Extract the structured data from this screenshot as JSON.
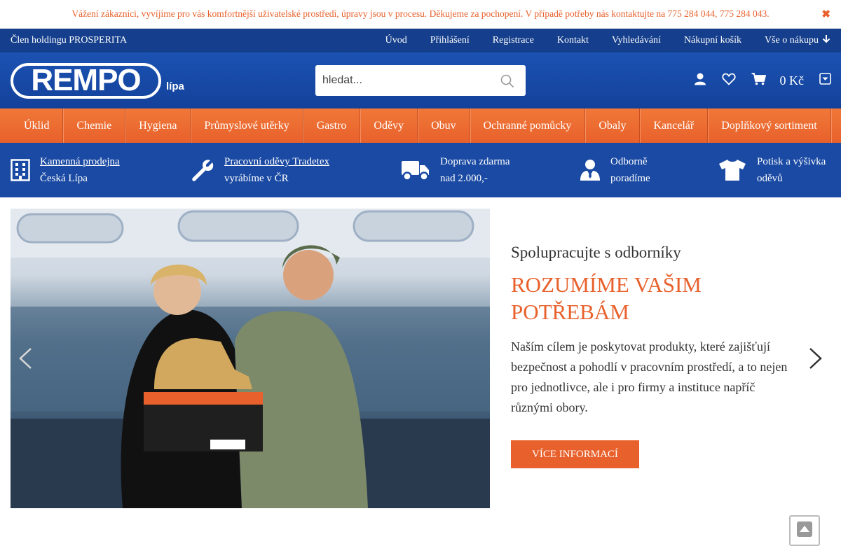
{
  "notice": {
    "text": "Vážení zákazníci, vyvíjíme pro vás komfortnější uživatelské prostředí, úpravy jsou v procesu. Děkujeme za pochopení. V případě potřeby nás kontaktujte na 775 284 044, 775 284 043.",
    "close_icon": "✖"
  },
  "topbar": {
    "holding": "Člen holdingu PROSPERITA",
    "links": [
      "Úvod",
      "Přihlášení",
      "Registrace",
      "Kontakt",
      "Vyhledávání",
      "Nákupní košík",
      "Vše o nákupu"
    ]
  },
  "header": {
    "logo_text": "REMPO",
    "logo_sub": "lípa",
    "search_placeholder": "hledat...",
    "cart_total": "0 Kč"
  },
  "categories": [
    "Úklid",
    "Chemie",
    "Hygiena",
    "Průmyslové utěrky",
    "Gastro",
    "Oděvy",
    "Obuv",
    "Ochranné pomůcky",
    "Obaly",
    "Kancelář",
    "Doplňkový sortiment"
  ],
  "benefits": [
    {
      "line1": "Kamenná prodejna",
      "line2": "Česká Lípa",
      "icon": "building-icon"
    },
    {
      "line1": "Pracovní oděvy Tradetex",
      "line2": "vyrábíme v ČR",
      "icon": "wrench-icon"
    },
    {
      "line1": "Doprava zdarma",
      "line2": "nad 2.000,-",
      "icon": "truck-icon"
    },
    {
      "line1": "Odborně",
      "line2": "poradíme",
      "icon": "advisor-icon"
    },
    {
      "line1": "Potisk a výšivka",
      "line2": "oděvů",
      "icon": "tshirt-icon"
    }
  ],
  "slide": {
    "subtitle": "Spolupracujte s odborníky",
    "title": "ROZUMÍME VAŠIM POTŘEBÁM",
    "description": "Naším cílem je poskytovat produkty, které zajišťují bezpečnost a pohodlí v pracovním prostředí, a to nejen pro jednotlivce, ale i pro firmy a instituce napříč různými obory.",
    "button": "VÍCE INFORMACÍ"
  },
  "colors": {
    "brand_blue": "#153f8c",
    "brand_orange": "#e8612c"
  }
}
